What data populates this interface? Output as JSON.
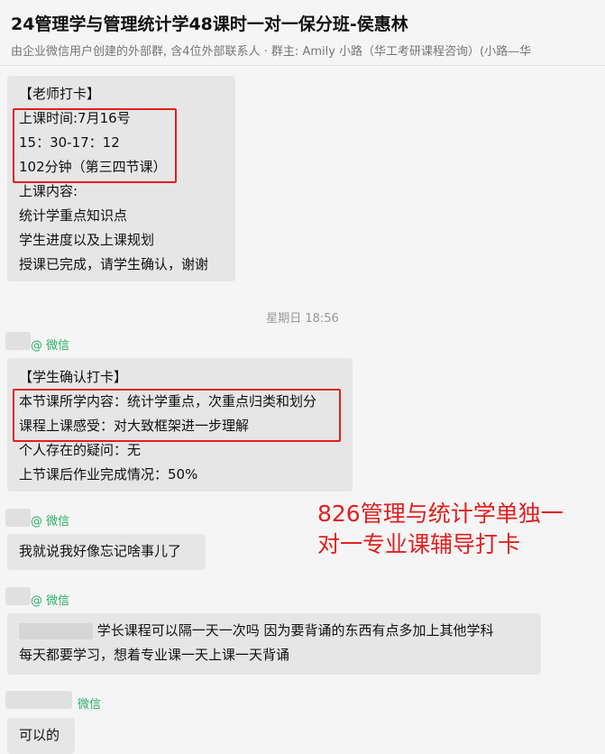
{
  "header": {
    "title": "24管理学与管理统计学48课时一对一保分班-侯惠林",
    "subtitle": "由企业微信用户创建的外部群, 含4位外部联系人 · 群主: Amily 小路（华工考研课程咨询）(小路—华"
  },
  "messages": {
    "teacher_checkin": {
      "lines": [
        "【老师打卡】",
        "上课时间:7月16号",
        "15：30-17：12",
        "102分钟（第三四节课）",
        "上课内容:",
        "统计学重点知识点",
        "学生进度以及上课规划",
        "授课已完成，请学生确认，谢谢"
      ]
    },
    "timestamp": "星期日 18:56",
    "student_checkin": {
      "sender_suffix": "@ 微信",
      "lines": [
        "【学生确认打卡】",
        "本节课所学内容：统计学重点，次重点归类和划分",
        "课程上课感受：对大致框架进一步理解",
        "个人存在的疑问：无",
        "上节课后作业完成情况：50%"
      ]
    },
    "forgot": {
      "sender_suffix": "@ 微信",
      "text": "我就说我好像忘记啥事儿了"
    },
    "request": {
      "sender_suffix": "@ 微信",
      "line1": "学长课程可以隔一天一次吗 因为要背诵的东西有点多加上其他学科",
      "line2": "每天都要学习，想着专业课一天上课一天背诵"
    },
    "reply": {
      "sender_suffix": "微信",
      "text": "可以的"
    }
  },
  "overlay": {
    "line1": "826管理与统计学单独一",
    "line2": "对一专业课辅导打卡"
  }
}
